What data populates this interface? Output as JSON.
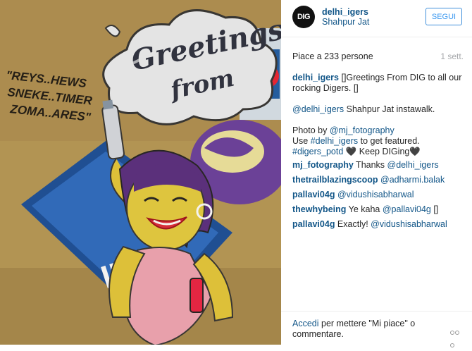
{
  "post": {
    "image_alt": "Greetings from street art mural",
    "mural_text": {
      "greetings": "Greetings",
      "from": "from",
      "tag_line1": "\"REYS..HEWS",
      "tag_line2": "SNEKE..TIMER",
      "tag_line3": "ZOMA..ARES\"",
      "india": "INDI"
    }
  },
  "header": {
    "avatar_text": "DIG",
    "username": "delhi_igers",
    "location": "Shahpur Jat",
    "follow_label": "SEGUI"
  },
  "stats": {
    "likes": "Piace a 233 persone",
    "time": "1 sett."
  },
  "caption": {
    "user": "delhi_igers",
    "line1": " []Greetings From DIG to all our rocking Digers. []",
    "mention1": "@delhi_igers",
    "line2": " Shahpur Jat instawalk.",
    "photo_by": "Photo by ",
    "mention2": "@mj_fotography",
    "use": "Use ",
    "hashtag1": "#delhi_igers",
    "featured": " to get featured.",
    "hashtag2": "#digers_potd",
    "keep": " 🖤 Keep DIGing🖤"
  },
  "comments": [
    {
      "user": "mj_fotography",
      "text": " Thanks ",
      "mention": "@delhi_igers",
      "tail": ""
    },
    {
      "user": "thetrailblazingscoop",
      "text": " ",
      "mention": "@adharmi.balak",
      "tail": ""
    },
    {
      "user": "pallavi04g",
      "text": " ",
      "mention": "@vidushisabharwal",
      "tail": ""
    },
    {
      "user": "thewhybeing",
      "text": " Ye kaha ",
      "mention": "@pallavi04g",
      "tail": " []"
    },
    {
      "user": "pallavi04g",
      "text": " Exactly! ",
      "mention": "@vidushisabharwal",
      "tail": ""
    }
  ],
  "footer": {
    "login_link": "Accedi",
    "login_text": " per mettere \"Mi piace\" o commentare."
  },
  "colors": {
    "link": "#125688",
    "follow_border": "#4090db",
    "muted": "#a5a7aa"
  }
}
